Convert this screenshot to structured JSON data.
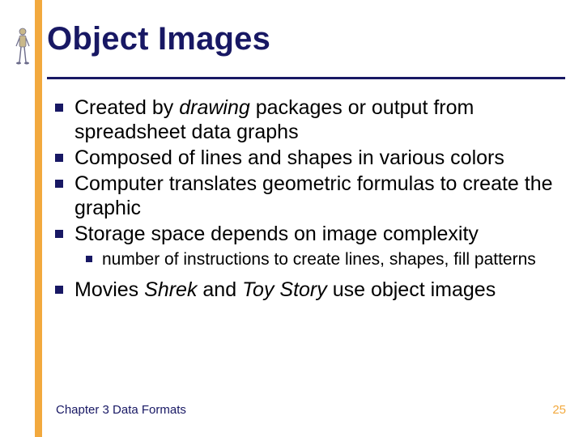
{
  "title": "Object Images",
  "bullets": [
    {
      "level": 1,
      "pre": "Created by ",
      "em": "drawing",
      "post": " packages or output from spreadsheet data graphs"
    },
    {
      "level": 1,
      "pre": "Composed of lines and shapes in various colors",
      "em": "",
      "post": ""
    },
    {
      "level": 1,
      "pre": "Computer translates geometric formulas to create the graphic",
      "em": "",
      "post": ""
    },
    {
      "level": 1,
      "pre": "Storage space depends on image complexity",
      "em": "",
      "post": ""
    },
    {
      "level": 2,
      "pre": "number of instructions to create lines, shapes, fill patterns",
      "em": "",
      "post": ""
    },
    {
      "level": 1,
      "pre": "Movies ",
      "em": "Shrek",
      "mid": " and ",
      "em2": "Toy Story",
      "post": " use object images"
    }
  ],
  "footer": {
    "left": "Chapter 3 Data Formats",
    "right": "25"
  }
}
